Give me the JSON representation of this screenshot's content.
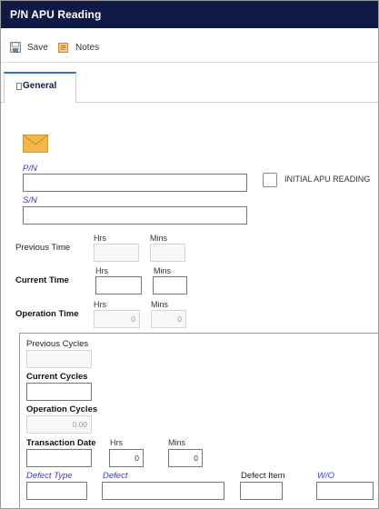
{
  "window": {
    "title": "P/N APU Reading"
  },
  "toolbar": {
    "save_label": "Save",
    "notes_label": "Notes"
  },
  "tabs": [
    {
      "label": "General"
    }
  ],
  "form": {
    "pn_label": "P/N",
    "pn_value": "",
    "sn_label": "S/N",
    "sn_value": "",
    "initial_apu_label": "INITIAL APU READING",
    "initial_apu_checked": false,
    "hrs_label": "Hrs",
    "mins_label": "Mins",
    "previous_time_label": "Previous Time",
    "current_time_label": "Current Time",
    "operation_time_label": "Operation Time",
    "operation_time_hrs": "0",
    "operation_time_mins": "0",
    "previous_cycles_label": "Previous Cycles",
    "current_cycles_label": "Current Cycles",
    "operation_cycles_label": "Operation Cycles",
    "operation_cycles_value": "0.00",
    "transaction_date_label": "Transaction Date",
    "transaction_hrs_value": "0",
    "transaction_mins_value": "0",
    "defect_type_label": "Defect Type",
    "defect_label": "Defect",
    "defect_item_label": "Defect Item",
    "wo_label": "W/O"
  },
  "colors": {
    "titlebar": "#111a44",
    "link_label": "#3a3acf",
    "tab_accent": "#2e6fbf",
    "envelope": "#f2b64a"
  }
}
